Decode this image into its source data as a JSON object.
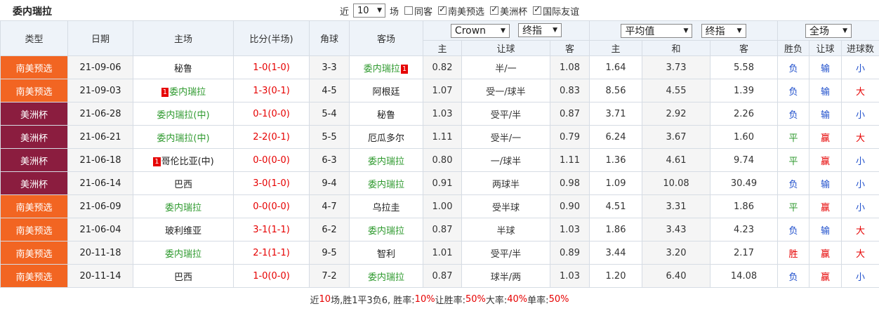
{
  "title": "委内瑞拉",
  "filters": {
    "recent_label": "近",
    "recent_value": "10",
    "games_label": "场",
    "options": [
      {
        "label": "同客",
        "checked": false
      },
      {
        "label": "南美预选",
        "checked": true
      },
      {
        "label": "美洲杯",
        "checked": true
      },
      {
        "label": "国际友谊",
        "checked": true
      }
    ]
  },
  "colors": {
    "wc": "#f26522",
    "ca": "#8b1d3f",
    "home_green": "#2f9a2f",
    "score_red": "#e60000",
    "result_blue": "#1f4fcc"
  },
  "header": {
    "type": "类型",
    "date": "日期",
    "home": "主场",
    "score": "比分(半场)",
    "corners": "角球",
    "away": "客场",
    "company": "Crown",
    "odds_mode": "终指",
    "avg": "平均值",
    "avg_mode": "终指",
    "scope": "全场",
    "sub": {
      "h": "主",
      "handicap": "让球",
      "a": "客",
      "h2": "主",
      "draw": "和",
      "a2": "客",
      "wl": "胜负",
      "hc": "让球",
      "goals": "进球数"
    }
  },
  "rows": [
    {
      "type": "南美预选",
      "cls": "wc",
      "date": "21-09-06",
      "home_rank": "",
      "home": "秘鲁",
      "home_hl": false,
      "score": "1-0(1-0)",
      "corners": "3-3",
      "away": "委内瑞拉",
      "away_rank": "1",
      "away_hl": true,
      "o1": "0.82",
      "hc": "半/一",
      "o2": "1.08",
      "a1": "1.64",
      "ad": "3.73",
      "a2": "5.58",
      "wl": "负",
      "hcr": "输",
      "g": "小"
    },
    {
      "type": "南美预选",
      "cls": "wc",
      "date": "21-09-03",
      "home_rank": "1",
      "home": "委内瑞拉",
      "home_hl": true,
      "score": "1-3(0-1)",
      "corners": "4-5",
      "away": "阿根廷",
      "away_rank": "",
      "away_hl": false,
      "o1": "1.07",
      "hc": "受一/球半",
      "o2": "0.83",
      "a1": "8.56",
      "ad": "4.55",
      "a2": "1.39",
      "wl": "负",
      "hcr": "输",
      "g": "大"
    },
    {
      "type": "美洲杯",
      "cls": "ca",
      "date": "21-06-28",
      "home_rank": "",
      "home": "委内瑞拉(中)",
      "home_hl": true,
      "score": "0-1(0-0)",
      "corners": "5-4",
      "away": "秘鲁",
      "away_rank": "",
      "away_hl": false,
      "o1": "1.03",
      "hc": "受平/半",
      "o2": "0.87",
      "a1": "3.71",
      "ad": "2.92",
      "a2": "2.26",
      "wl": "负",
      "hcr": "输",
      "g": "小"
    },
    {
      "type": "美洲杯",
      "cls": "ca",
      "date": "21-06-21",
      "home_rank": "",
      "home": "委内瑞拉(中)",
      "home_hl": true,
      "score": "2-2(0-1)",
      "corners": "5-5",
      "away": "厄瓜多尔",
      "away_rank": "",
      "away_hl": false,
      "o1": "1.11",
      "hc": "受半/一",
      "o2": "0.79",
      "a1": "6.24",
      "ad": "3.67",
      "a2": "1.60",
      "wl": "平",
      "hcr": "赢",
      "g": "大"
    },
    {
      "type": "美洲杯",
      "cls": "ca",
      "date": "21-06-18",
      "home_rank": "1",
      "home": "哥伦比亚(中)",
      "home_hl": false,
      "score": "0-0(0-0)",
      "corners": "6-3",
      "away": "委内瑞拉",
      "away_rank": "",
      "away_hl": true,
      "o1": "0.80",
      "hc": "一/球半",
      "o2": "1.11",
      "a1": "1.36",
      "ad": "4.61",
      "a2": "9.74",
      "wl": "平",
      "hcr": "赢",
      "g": "小"
    },
    {
      "type": "美洲杯",
      "cls": "ca",
      "date": "21-06-14",
      "home_rank": "",
      "home": "巴西",
      "home_hl": false,
      "score": "3-0(1-0)",
      "corners": "9-4",
      "away": "委内瑞拉",
      "away_rank": "",
      "away_hl": true,
      "o1": "0.91",
      "hc": "两球半",
      "o2": "0.98",
      "a1": "1.09",
      "ad": "10.08",
      "a2": "30.49",
      "wl": "负",
      "hcr": "输",
      "g": "小"
    },
    {
      "type": "南美预选",
      "cls": "wc",
      "date": "21-06-09",
      "home_rank": "",
      "home": "委内瑞拉",
      "home_hl": true,
      "score": "0-0(0-0)",
      "corners": "4-7",
      "away": "乌拉圭",
      "away_rank": "",
      "away_hl": false,
      "o1": "1.00",
      "hc": "受半球",
      "o2": "0.90",
      "a1": "4.51",
      "ad": "3.31",
      "a2": "1.86",
      "wl": "平",
      "hcr": "赢",
      "g": "小"
    },
    {
      "type": "南美预选",
      "cls": "wc",
      "date": "21-06-04",
      "home_rank": "",
      "home": "玻利维亚",
      "home_hl": false,
      "score": "3-1(1-1)",
      "corners": "6-2",
      "away": "委内瑞拉",
      "away_rank": "",
      "away_hl": true,
      "o1": "0.87",
      "hc": "半球",
      "o2": "1.03",
      "a1": "1.86",
      "ad": "3.43",
      "a2": "4.23",
      "wl": "负",
      "hcr": "输",
      "g": "大"
    },
    {
      "type": "南美预选",
      "cls": "wc",
      "date": "20-11-18",
      "home_rank": "",
      "home": "委内瑞拉",
      "home_hl": true,
      "score": "2-1(1-1)",
      "corners": "9-5",
      "away": "智利",
      "away_rank": "",
      "away_hl": false,
      "o1": "1.01",
      "hc": "受平/半",
      "o2": "0.89",
      "a1": "3.44",
      "ad": "3.20",
      "a2": "2.17",
      "wl": "胜",
      "hcr": "赢",
      "g": "大"
    },
    {
      "type": "南美预选",
      "cls": "wc",
      "date": "20-11-14",
      "home_rank": "",
      "home": "巴西",
      "home_hl": false,
      "score": "1-0(0-0)",
      "corners": "7-2",
      "away": "委内瑞拉",
      "away_rank": "",
      "away_hl": true,
      "o1": "0.87",
      "hc": "球半/两",
      "o2": "1.03",
      "a1": "1.20",
      "ad": "6.40",
      "a2": "14.08",
      "wl": "负",
      "hcr": "赢",
      "g": "小"
    }
  ],
  "summary": {
    "p1": "近",
    "games": "10",
    "p2": "场,胜1平3负6, 胜率:",
    "win_rate": "10%",
    "p3": " 让胜率:",
    "hc_rate": "50%",
    "p4": " 大率:",
    "big_rate": "40%",
    "p5": " 单率:",
    "odd_rate": "50%"
  }
}
